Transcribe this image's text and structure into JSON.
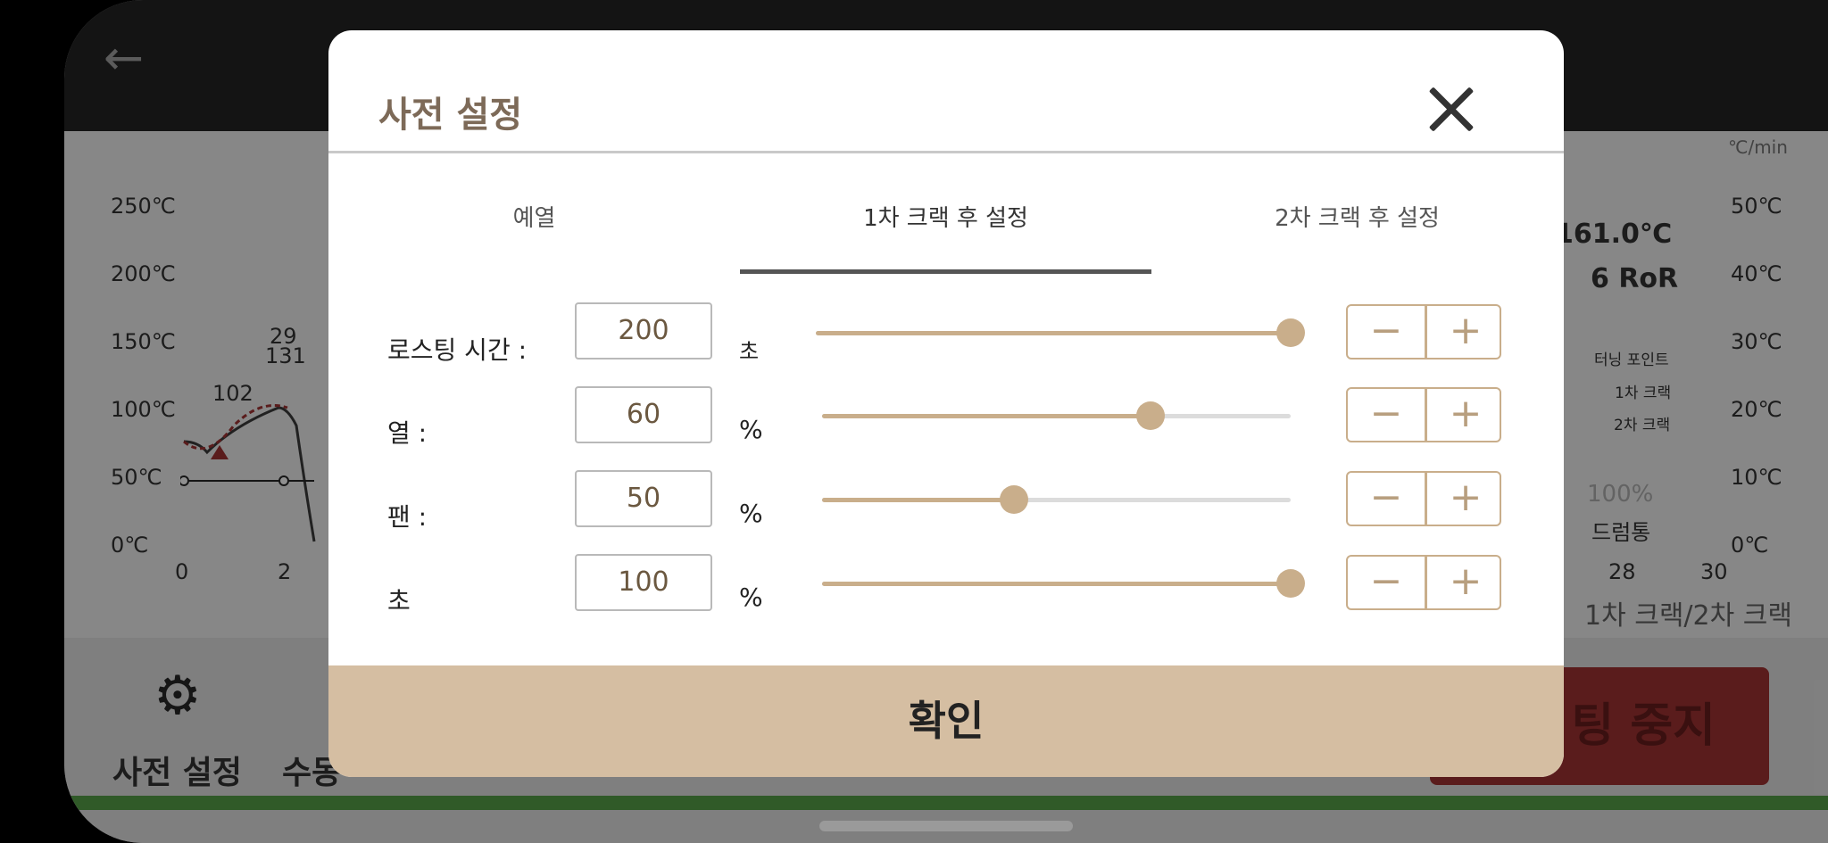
{
  "background": {
    "y_axis_left": [
      "250℃",
      "200℃",
      "150℃",
      "100℃",
      "50℃",
      "0℃"
    ],
    "y_axis_right": [
      "50℃",
      "40℃",
      "30℃",
      "20℃",
      "10℃",
      "0℃"
    ],
    "right_unit": "℃/min",
    "x_ticks": [
      "0",
      "2",
      "28",
      "30"
    ],
    "point_labels": [
      "29",
      "131",
      "102"
    ],
    "temp_readout": "161.0℃",
    "ror_readout": "6 RoR",
    "legend": [
      "터닝 포인트",
      "1차 크랙",
      "2차 크랙"
    ],
    "drum_percent": "100%",
    "drum_label": "드럼통",
    "crack_label": "1차 크랙/2차 크랙",
    "settings_label": "사전 설정",
    "manual_label": "수동",
    "stop_label": "팅 중지"
  },
  "modal": {
    "title": "사전 설정",
    "tabs": [
      {
        "label": "예열",
        "active": false
      },
      {
        "label": "1차 크랙 후 설정",
        "active": true
      },
      {
        "label": "2차 크랙 후 설정",
        "active": false
      }
    ],
    "rows": [
      {
        "label": "로스팅 시간 :",
        "value": "200",
        "unit": "초",
        "level": 1.0
      },
      {
        "label": "열 :",
        "value": "60",
        "unit": "%",
        "level": 0.7
      },
      {
        "label": "팬 :",
        "value": "50",
        "unit": "%",
        "level": 0.41
      },
      {
        "label": "초",
        "value": "100",
        "unit": "%",
        "level": 1.0
      }
    ],
    "minus_symbol": "−",
    "plus_symbol": "+",
    "confirm_label": "확인"
  },
  "colors": {
    "accent": "#c9ae8b",
    "title": "#7d6a58",
    "confirm_bg": "#d5bea2",
    "stop_red": "#8a2c2c"
  }
}
